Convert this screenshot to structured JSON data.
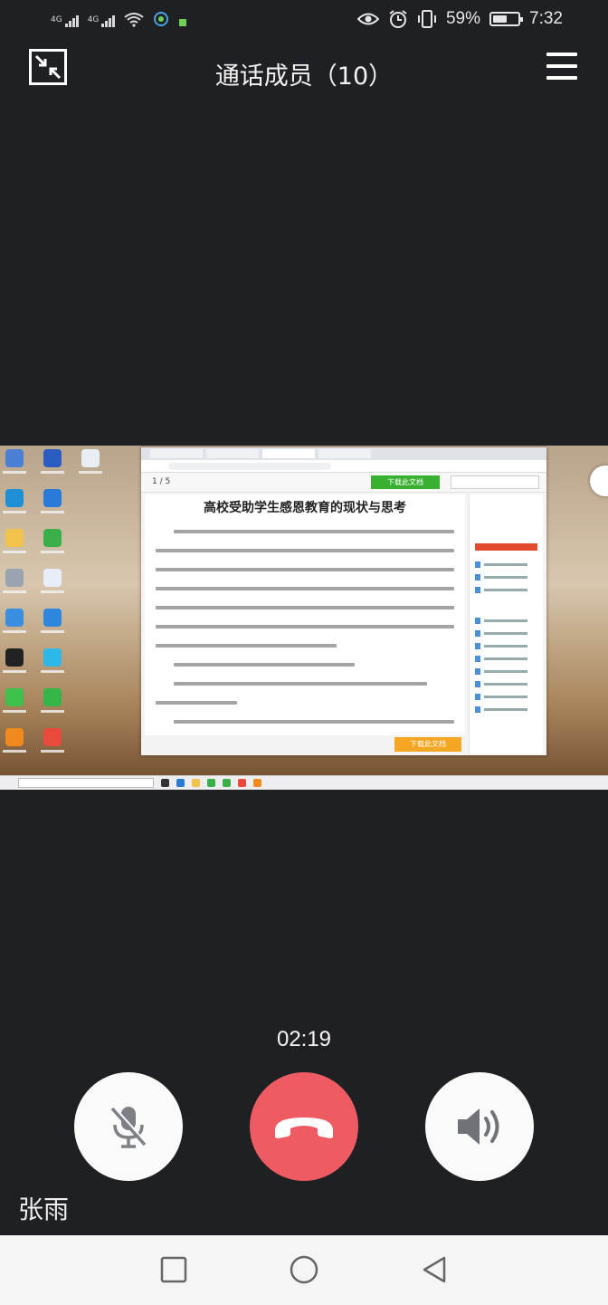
{
  "status_bar": {
    "signal_1_label": "4G",
    "signal_2_label": "4G",
    "battery_percent": "59%",
    "battery_level": 0.59,
    "time": "7:32",
    "icons": [
      "signal-icon",
      "wifi-icon",
      "app-notification-icon",
      "eye-icon",
      "alarm-icon",
      "vibrate-icon",
      "battery-icon"
    ]
  },
  "header": {
    "title": "通话成员（10）",
    "left_icon": "shrink-window-icon",
    "right_icon": "menu-icon"
  },
  "shared_screen": {
    "doc_page_indicator": "1 / 5",
    "doc_title": "高校受助学生感恩教育的现状与思考",
    "download_label": "下载此文档"
  },
  "call": {
    "duration": "02:19",
    "caller_name": "张雨",
    "buttons": [
      "mic-muted-icon",
      "hang-up-icon",
      "speaker-icon"
    ]
  },
  "colors": {
    "background": "#1f2023",
    "hangup": "#ef5b63",
    "control": "#fafafa"
  }
}
